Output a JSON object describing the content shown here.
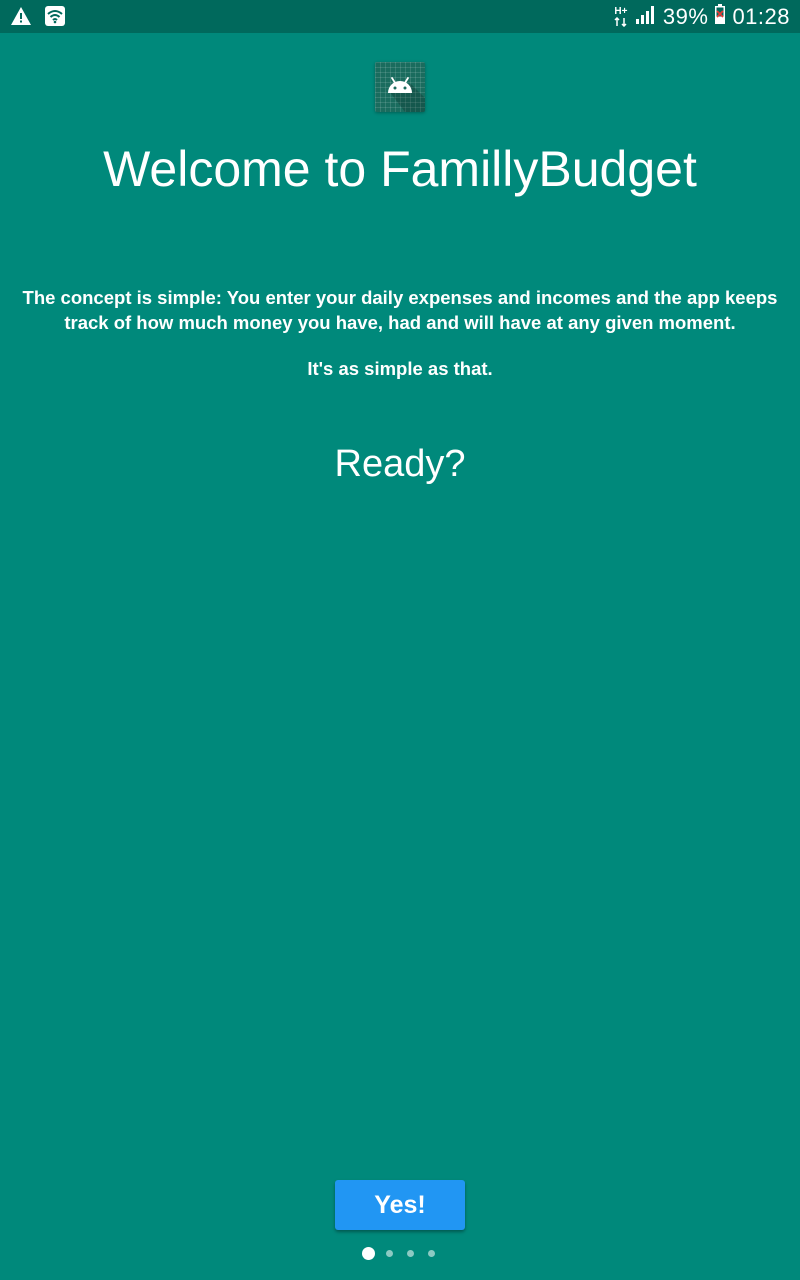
{
  "status_bar": {
    "left_icons": [
      "warning-icon",
      "wifi-icon"
    ],
    "network_type": "H+",
    "battery_percent": "39%",
    "time": "01:28",
    "right_icons": [
      "network-data-icon",
      "signal-icon",
      "battery-icon"
    ]
  },
  "app": {
    "icon": "android-icon",
    "title": "Welcome to FamillyBudget",
    "description": "The concept is simple: You enter your daily expenses and incomes and the app keeps track of how much money you have, had and will have at any given moment.",
    "tagline": "It's as simple as that.",
    "ready": "Ready?",
    "yes_button_label": "Yes!"
  },
  "pager": {
    "total_pages": 4,
    "current_page": 1
  },
  "colors": {
    "background": "#00897B",
    "status_bar": "#00695C",
    "button": "#2196F3",
    "text": "#FFFFFF"
  }
}
